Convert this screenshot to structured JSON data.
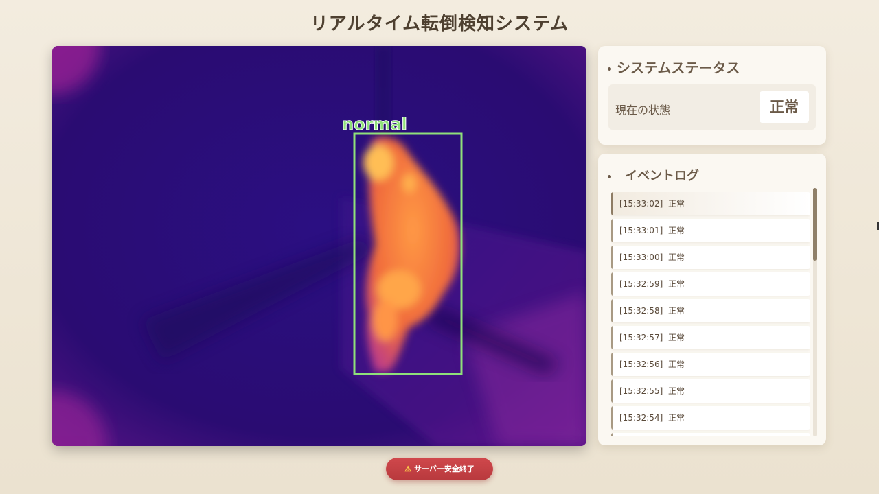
{
  "page": {
    "title": "リアルタイム転倒検知システム"
  },
  "video": {
    "detection_label": "normal",
    "box_color": "#8fe07a",
    "palette": [
      "#2a0d7a",
      "#c23aa0",
      "#ff8a3a",
      "#ffc25a"
    ]
  },
  "status_card": {
    "heading": "システムステータス",
    "current_label": "現在の状態",
    "current_value": "正常"
  },
  "event_log": {
    "heading": "イベントログ",
    "entries": [
      {
        "time": "[15:33:02]",
        "status": "正常"
      },
      {
        "time": "[15:33:01]",
        "status": "正常"
      },
      {
        "time": "[15:33:00]",
        "status": "正常"
      },
      {
        "time": "[15:32:59]",
        "status": "正常"
      },
      {
        "time": "[15:32:58]",
        "status": "正常"
      },
      {
        "time": "[15:32:57]",
        "status": "正常"
      },
      {
        "time": "[15:32:56]",
        "status": "正常"
      },
      {
        "time": "[15:32:55]",
        "status": "正常"
      },
      {
        "time": "[15:32:54]",
        "status": "正常"
      }
    ]
  },
  "controls": {
    "shutdown_icon": "warning-icon",
    "shutdown_label": "サーバー安全終了"
  }
}
